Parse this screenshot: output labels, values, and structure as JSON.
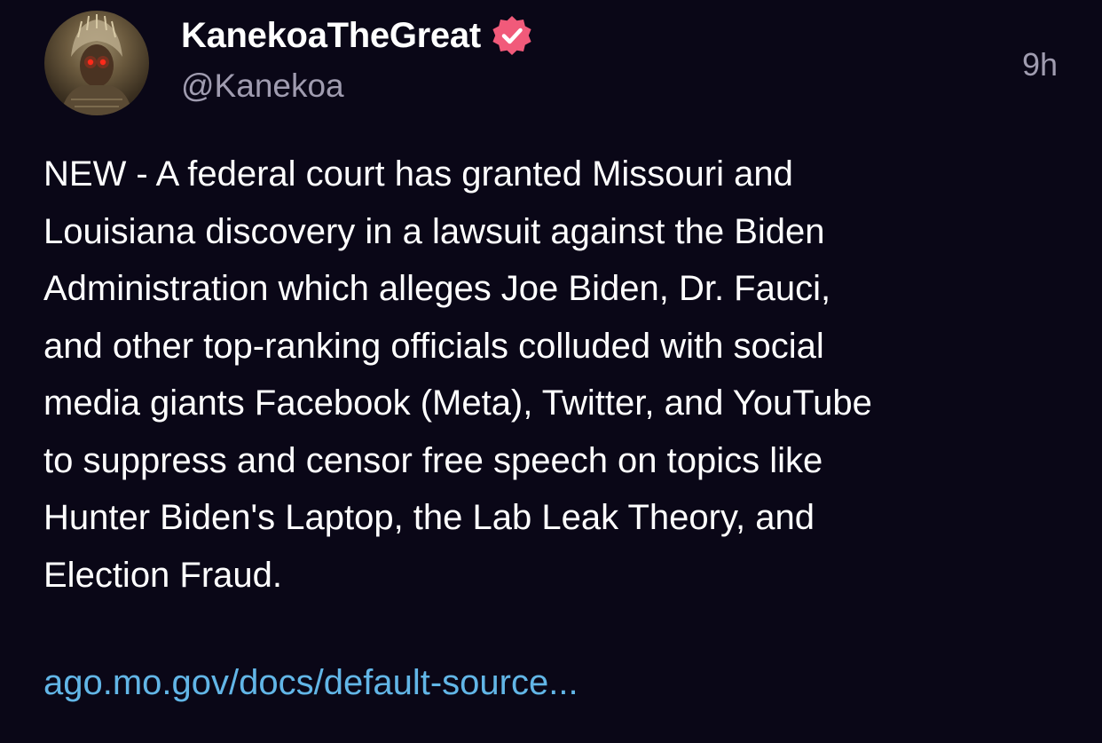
{
  "post": {
    "author": {
      "display_name": "KanekoaTheGreat",
      "handle": "@Kanekoa",
      "verified_icon": "verified-badge-icon",
      "verified_color": "#f15a7a"
    },
    "timestamp": "9h",
    "text": "NEW - A federal court has granted Missouri and\nLouisiana discovery in a lawsuit against the Biden\nAdministration which alleges Joe Biden, Dr. Fauci,\nand other top-ranking officials colluded with social\nmedia giants Facebook (Meta), Twitter, and YouTube\nto suppress and censor free speech on topics like\nHunter Biden's Laptop, the Lab Leak Theory, and\nElection Fraud.",
    "link_text": "ago.mo.gov/docs/default-source...",
    "colors": {
      "background": "#0a0717",
      "text": "#ffffff",
      "muted": "#a09cb0",
      "link": "#62b6e7"
    }
  }
}
